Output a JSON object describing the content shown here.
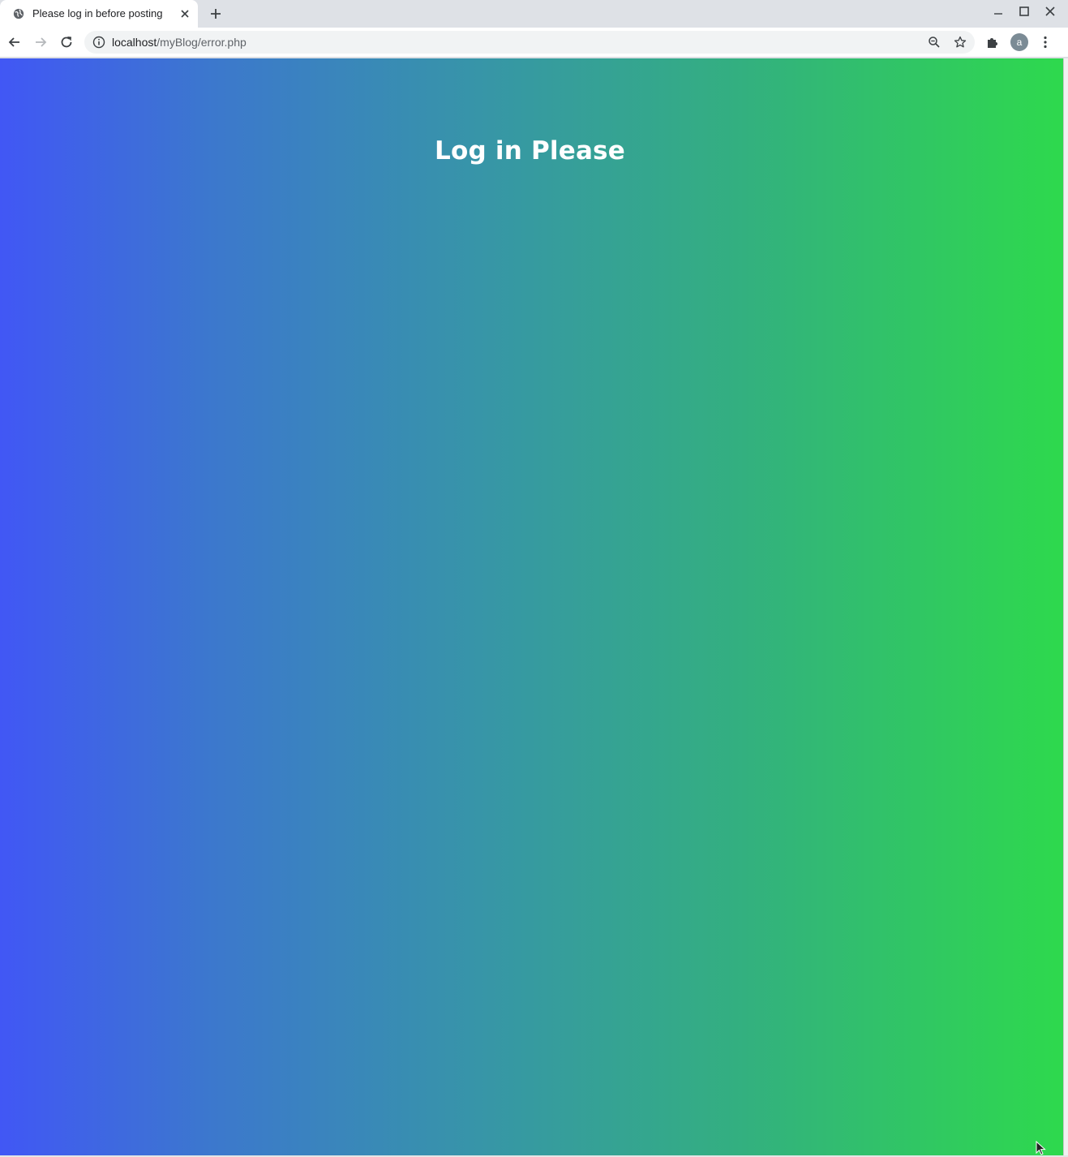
{
  "browser": {
    "tab": {
      "title": "Please log in before posting"
    },
    "address_bar": {
      "host": "localhost",
      "path": "/myBlog/error.php"
    },
    "profile_initial": "a"
  },
  "page": {
    "heading": "Log in Please",
    "background_gradient": [
      "#4157f5",
      "#3c78cd",
      "#3795a8",
      "#33b07f",
      "#2ed94d"
    ]
  }
}
